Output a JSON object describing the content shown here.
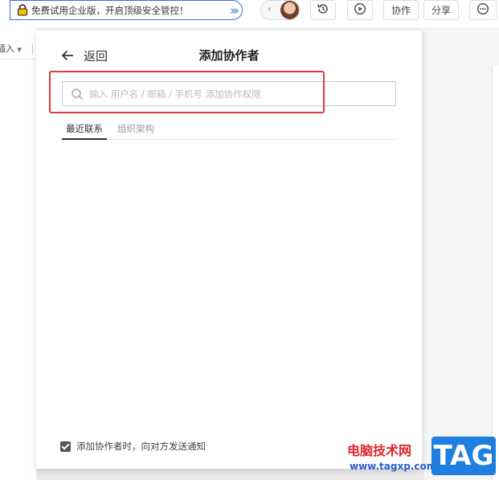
{
  "toolbar": {
    "promo_text": "免费试用企业版，开启顶级安全管控！",
    "collab_label": "协作",
    "share_label": "分享"
  },
  "doc": {
    "insert_label": "插入"
  },
  "panel": {
    "back_label": "返回",
    "title": "添加协作者",
    "search_placeholder": "输入 用户名 / 邮箱 / 手机号 添加协作权限",
    "tabs": [
      {
        "label": "最近联系",
        "active": true
      },
      {
        "label": "组织架构",
        "active": false
      }
    ],
    "notify_label": "添加协作者时，向对方发送通知",
    "notify_checked": true
  },
  "watermark": {
    "site_name": "电脑技术网",
    "url": "www.tagxp.com",
    "tag": "TAG"
  },
  "colors": {
    "accent_blue": "#3d6fd9",
    "highlight_red": "#e03a3a",
    "watermark_red": "#e0262b",
    "tag_blue": "#1e7fe0"
  }
}
